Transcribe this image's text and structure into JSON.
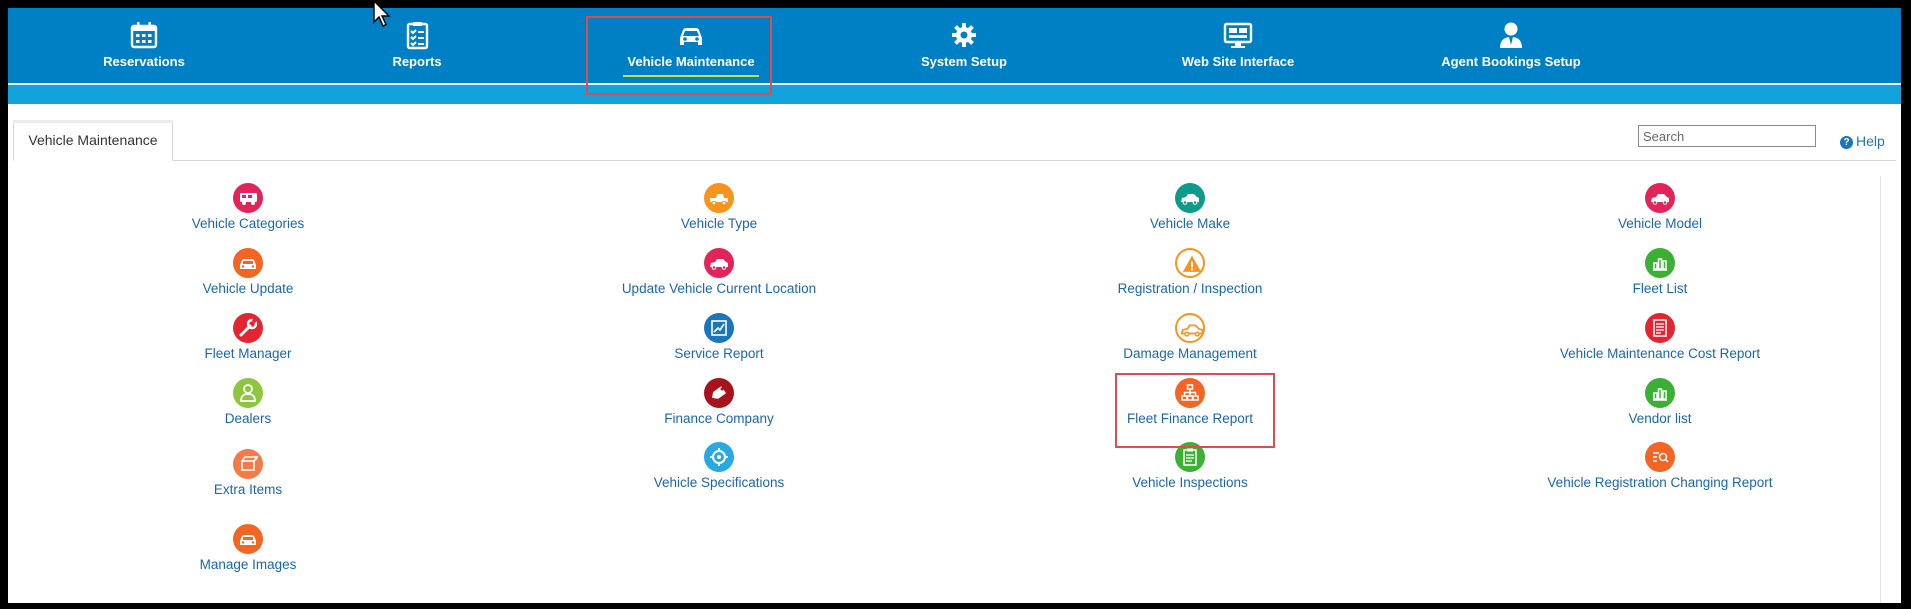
{
  "nav": {
    "items": [
      {
        "label": "Reservations",
        "icon": "calendar-icon"
      },
      {
        "label": "Reports",
        "icon": "checklist-icon"
      },
      {
        "label": "Vehicle Maintenance",
        "icon": "car-icon"
      },
      {
        "label": "System Setup",
        "icon": "gear-icon"
      },
      {
        "label": "Web Site Interface",
        "icon": "monitor-icon"
      },
      {
        "label": "Agent Bookings Setup",
        "icon": "agent-icon"
      }
    ],
    "active": "Vehicle Maintenance"
  },
  "tab": {
    "label": "Vehicle Maintenance"
  },
  "search": {
    "placeholder": "Search"
  },
  "help": {
    "label": "Help"
  },
  "colors": {
    "nav_bg": "#0080c4",
    "subbar": "#12a3dd",
    "link": "#1a66ad",
    "highlight": "#e04b4b"
  },
  "grid": {
    "col1": [
      {
        "label": "Vehicle Categories",
        "icon": "rv-icon",
        "color": "#e2245a"
      },
      {
        "label": "Vehicle Update",
        "icon": "car-front-icon",
        "color": "#f26522"
      },
      {
        "label": "Fleet Manager",
        "icon": "wrench-icon",
        "color": "#e22530"
      },
      {
        "label": "Dealers",
        "icon": "user-icon",
        "color": "#8dc63f"
      },
      {
        "label": "Extra Items",
        "icon": "box-icon",
        "color": "#f47b47"
      },
      {
        "label": "Manage Images",
        "icon": "car-front-icon",
        "color": "#f26522"
      }
    ],
    "col2": [
      {
        "label": "Vehicle Type",
        "icon": "pickup-icon",
        "color": "#f7941d"
      },
      {
        "label": "Update Vehicle Current Location",
        "icon": "car-side-icon",
        "color": "#e2245a"
      },
      {
        "label": "Service Report",
        "icon": "chart-icon",
        "color": "#1b75bb"
      },
      {
        "label": "Finance Company",
        "icon": "tag-icon",
        "color": "#a8121d"
      },
      {
        "label": "Vehicle Specifications",
        "icon": "cog-icon",
        "color": "#27aae1"
      }
    ],
    "col3": [
      {
        "label": "Vehicle Make",
        "icon": "car-side-icon",
        "color": "#0f9a8a"
      },
      {
        "label": "Registration / Inspection",
        "icon": "warning-icon",
        "color": "#f7941d"
      },
      {
        "label": "Damage Management",
        "icon": "car-outline-icon",
        "color": "#f7941d"
      },
      {
        "label": "Fleet Finance Report",
        "icon": "org-chart-icon",
        "color": "#f26522"
      },
      {
        "label": "Vehicle Inspections",
        "icon": "clipboard-icon",
        "color": "#3cb034"
      }
    ],
    "col4": [
      {
        "label": "Vehicle Model",
        "icon": "car-side-icon",
        "color": "#e2245a"
      },
      {
        "label": "Fleet List",
        "icon": "bar-chart-icon",
        "color": "#3cb034"
      },
      {
        "label": "Vehicle Maintenance Cost Report",
        "icon": "document-icon",
        "color": "#e22530"
      },
      {
        "label": "Vendor list",
        "icon": "bar-chart-icon",
        "color": "#3cb034"
      },
      {
        "label": "Vehicle Registration Changing Report",
        "icon": "search-doc-icon",
        "color": "#f26522"
      }
    ]
  }
}
